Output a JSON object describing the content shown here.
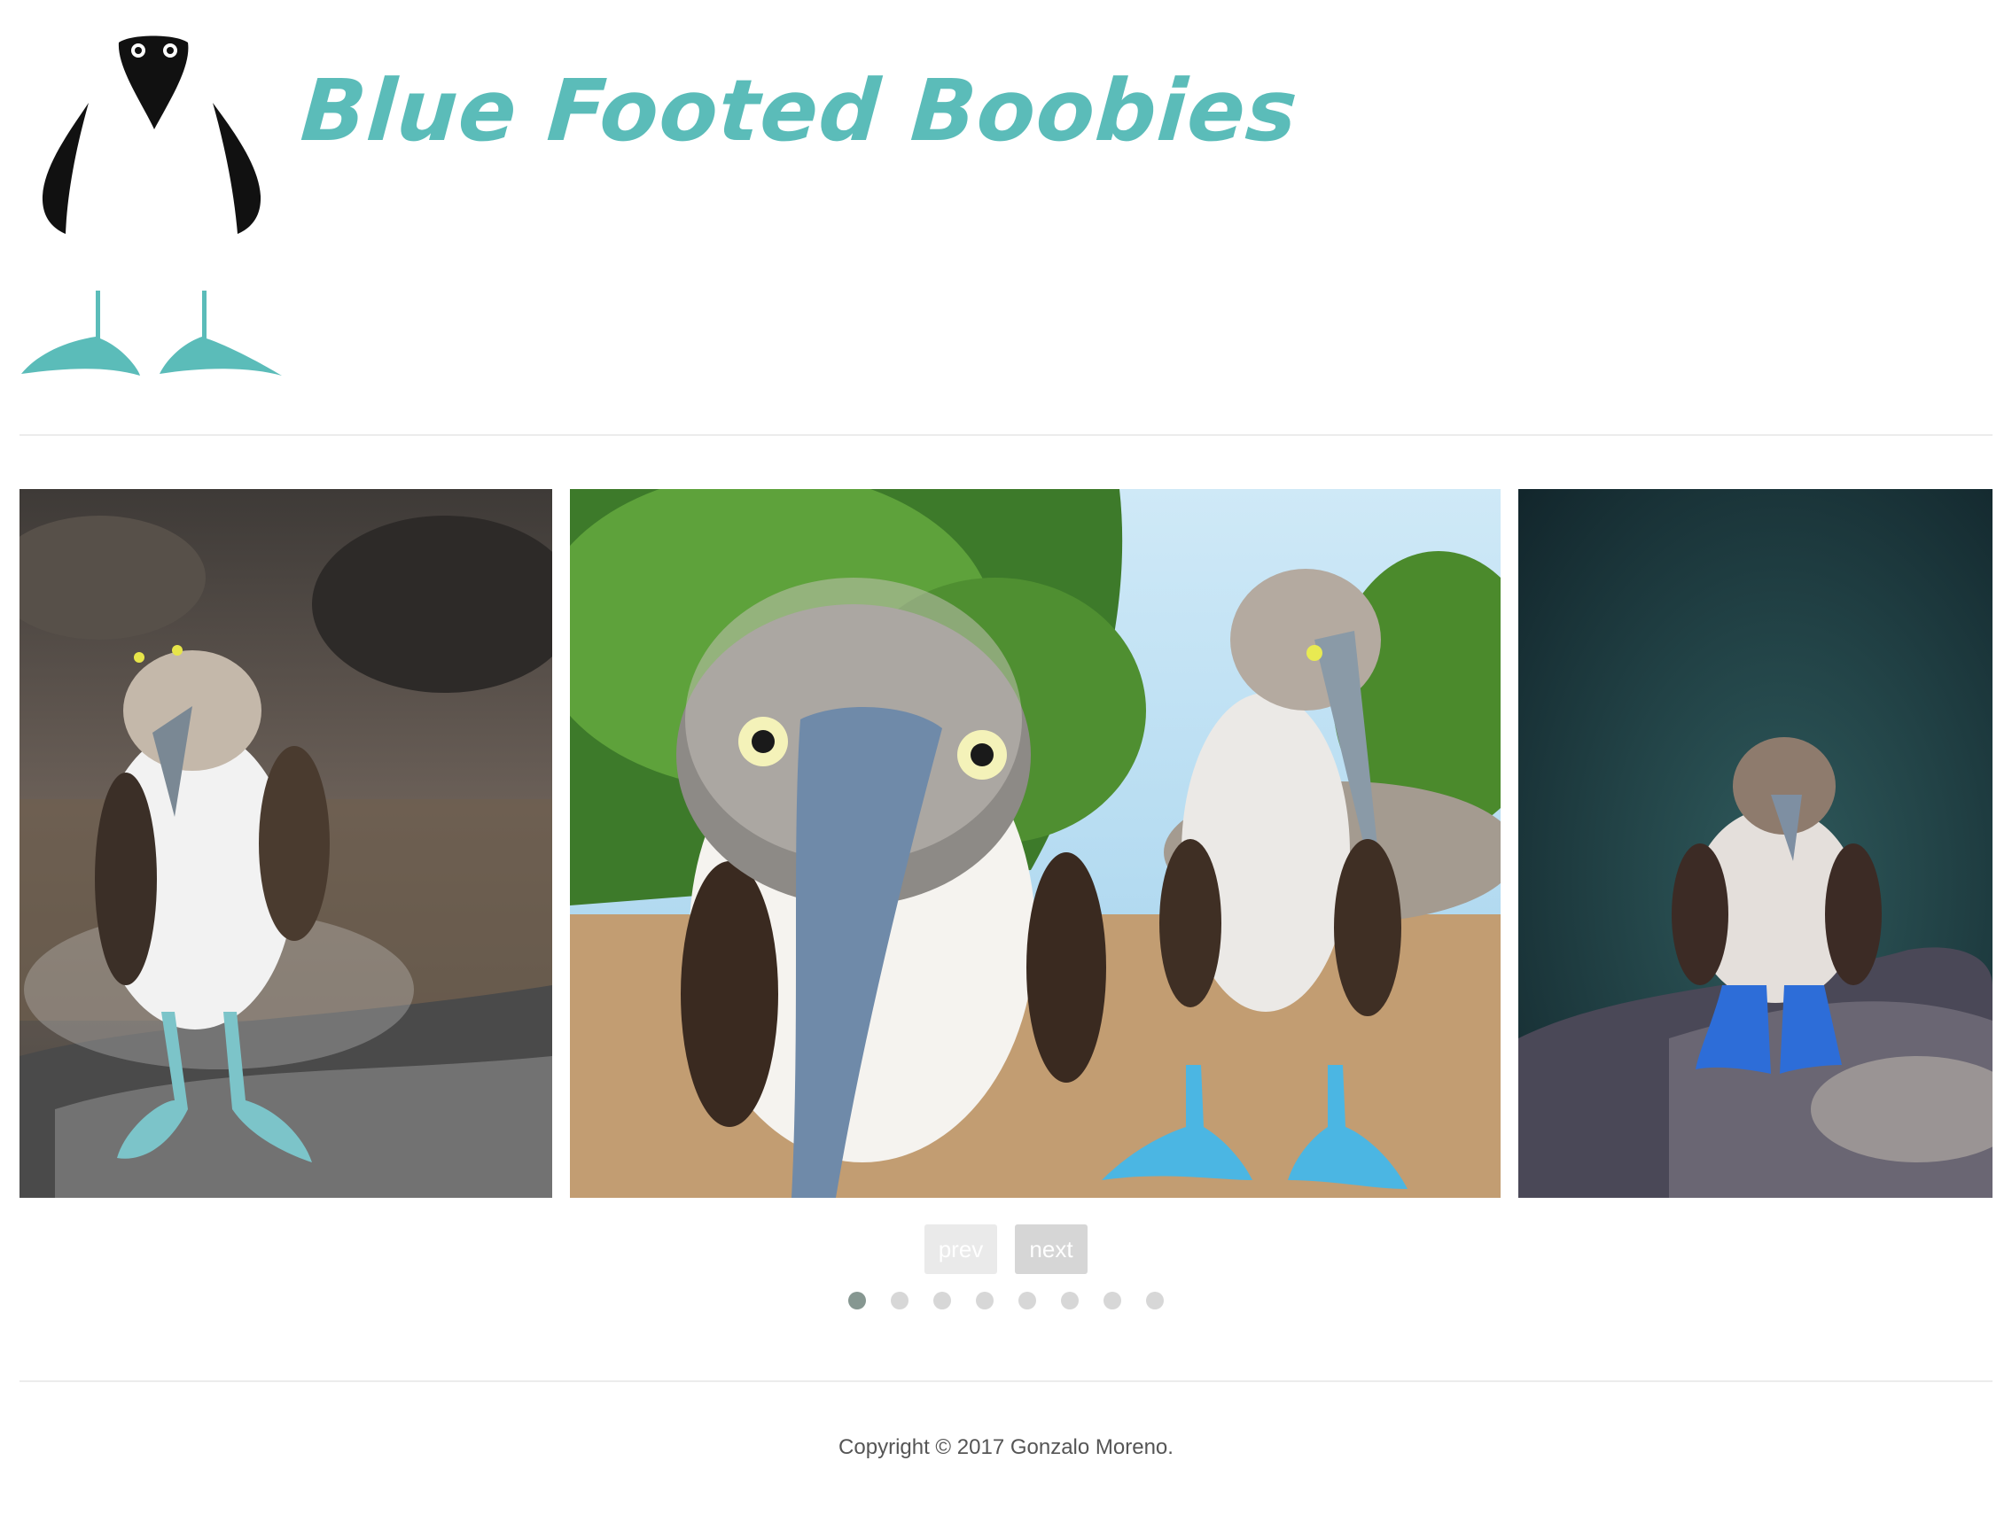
{
  "header": {
    "title": "Blue Footed Boobies",
    "logo_icon": "blue-footed-booby-logo",
    "title_color": "#5bbcb9"
  },
  "carousel": {
    "slides": [
      {
        "icon": "booby-on-rock-photo"
      },
      {
        "icon": "two-boobies-closeup-photo"
      },
      {
        "icon": "booby-dark-background-photo"
      }
    ],
    "prev_label": "prev",
    "next_label": "next",
    "dot_count": 8,
    "active_dot": 1
  },
  "footer": {
    "copyright": "Copyright © 2017 Gonzalo Moreno."
  },
  "colors": {
    "accent": "#5bbcb9",
    "dot_active": "#869791",
    "dot_inactive": "#d7d7d7"
  }
}
